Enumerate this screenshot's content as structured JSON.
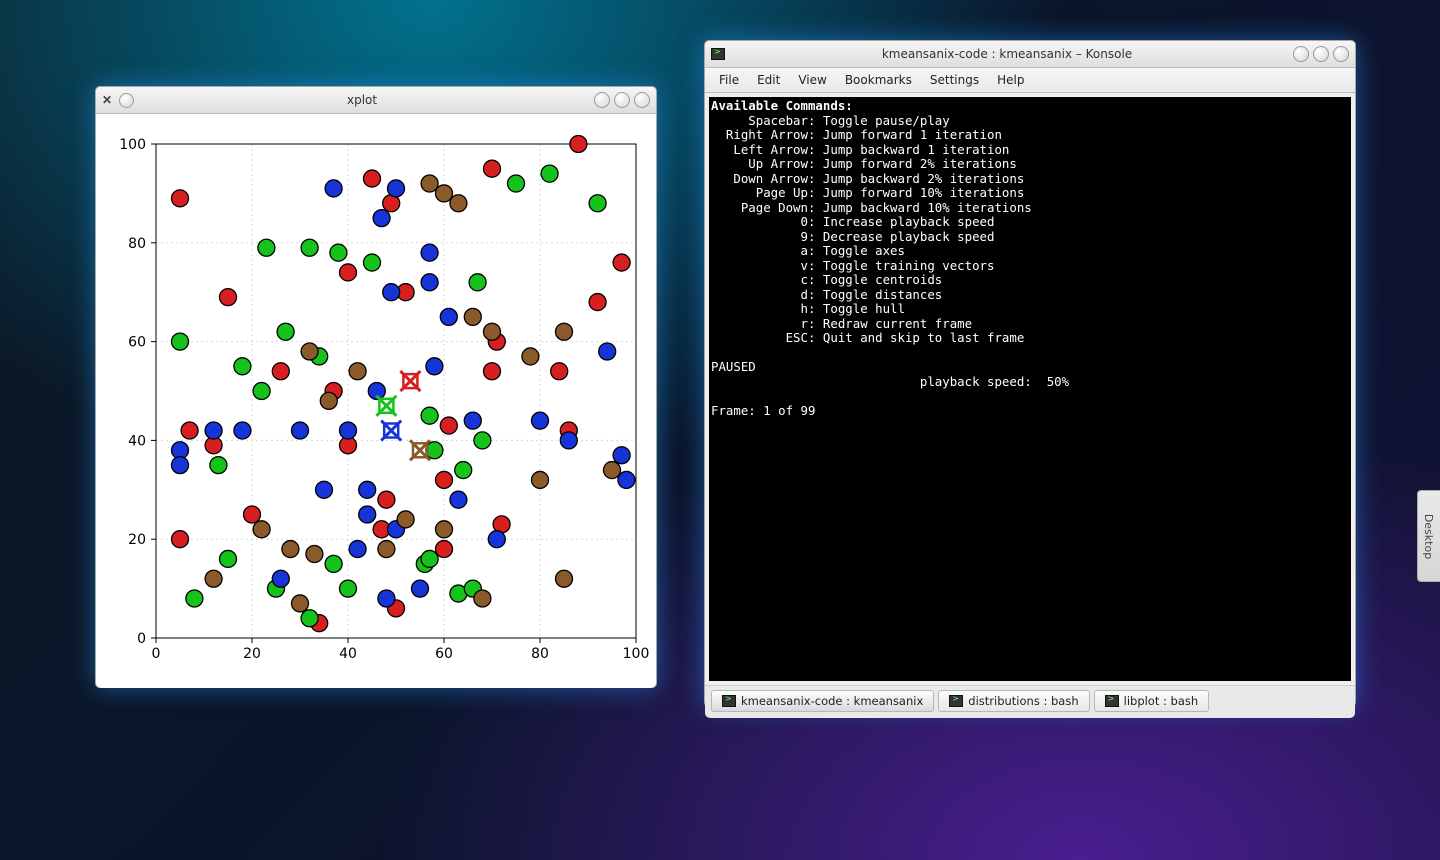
{
  "xplot": {
    "title": "xplot"
  },
  "konsole": {
    "title": "kmeansanix-code : kmeansanix – Konsole",
    "menu": [
      "File",
      "Edit",
      "View",
      "Bookmarks",
      "Settings",
      "Help"
    ],
    "tabs": [
      {
        "label": "kmeansanix-code : kmeansanix",
        "active": true
      },
      {
        "label": "distributions : bash",
        "active": false
      },
      {
        "label": "libplot : bash",
        "active": false
      }
    ],
    "terminal": {
      "heading": "Available Commands:",
      "cmds": [
        [
          "Spacebar",
          "Toggle pause/play"
        ],
        [
          "Right Arrow",
          "Jump forward 1 iteration"
        ],
        [
          "Left Arrow",
          "Jump backward 1 iteration"
        ],
        [
          "Up Arrow",
          "Jump forward 2% iterations"
        ],
        [
          "Down Arrow",
          "Jump backward 2% iterations"
        ],
        [
          "Page Up",
          "Jump forward 10% iterations"
        ],
        [
          "Page Down",
          "Jump backward 10% iterations"
        ],
        [
          "0",
          "Increase playback speed"
        ],
        [
          "9",
          "Decrease playback speed"
        ],
        [
          "a",
          "Toggle axes"
        ],
        [
          "v",
          "Toggle training vectors"
        ],
        [
          "c",
          "Toggle centroids"
        ],
        [
          "d",
          "Toggle distances"
        ],
        [
          "h",
          "Toggle hull"
        ],
        [
          "r",
          "Redraw current frame"
        ],
        [
          "ESC",
          "Quit and skip to last frame"
        ]
      ],
      "status_paused": "PAUSED",
      "speed_label": "playback speed:",
      "speed_value": "50%",
      "frame_line": "Frame: 1 of 99"
    }
  },
  "side_strip": {
    "label": "Desktop"
  },
  "chart_data": {
    "type": "scatter",
    "title": "",
    "xlabel": "",
    "ylabel": "",
    "xlim": [
      0,
      100
    ],
    "ylim": [
      0,
      100
    ],
    "x_ticks": [
      0,
      20,
      40,
      60,
      80,
      100
    ],
    "y_ticks": [
      0,
      20,
      40,
      60,
      80,
      100
    ],
    "grid": true,
    "centroids": [
      {
        "name": "red",
        "color": "#d81f1f",
        "x": 53,
        "y": 52
      },
      {
        "name": "green",
        "color": "#16c31a",
        "x": 48,
        "y": 47
      },
      {
        "name": "blue",
        "color": "#1634d8",
        "x": 49,
        "y": 42
      },
      {
        "name": "brown",
        "color": "#8a5a2a",
        "x": 55,
        "y": 38
      }
    ],
    "series": [
      {
        "name": "red",
        "color": "#d81f1f",
        "points": [
          [
            5,
            89
          ],
          [
            15,
            69
          ],
          [
            40,
            74
          ],
          [
            45,
            93
          ],
          [
            49,
            88
          ],
          [
            52,
            70
          ],
          [
            70,
            95
          ],
          [
            71,
            60
          ],
          [
            88,
            100
          ],
          [
            97,
            76
          ],
          [
            26,
            54
          ],
          [
            37,
            50
          ],
          [
            40,
            39
          ],
          [
            61,
            43
          ],
          [
            60,
            32
          ],
          [
            70,
            54
          ],
          [
            84,
            54
          ],
          [
            92,
            68
          ],
          [
            48,
            28
          ],
          [
            47,
            22
          ],
          [
            60,
            18
          ],
          [
            86,
            42
          ],
          [
            72,
            23
          ],
          [
            50,
            6
          ],
          [
            34,
            3
          ],
          [
            5,
            20
          ],
          [
            12,
            39
          ],
          [
            20,
            25
          ],
          [
            7,
            42
          ]
        ]
      },
      {
        "name": "green",
        "color": "#16c31a",
        "points": [
          [
            23,
            79
          ],
          [
            32,
            79
          ],
          [
            38,
            78
          ],
          [
            45,
            76
          ],
          [
            67,
            72
          ],
          [
            75,
            92
          ],
          [
            82,
            94
          ],
          [
            92,
            88
          ],
          [
            5,
            60
          ],
          [
            13,
            35
          ],
          [
            18,
            55
          ],
          [
            22,
            50
          ],
          [
            27,
            62
          ],
          [
            34,
            57
          ],
          [
            57,
            45
          ],
          [
            58,
            38
          ],
          [
            64,
            34
          ],
          [
            68,
            40
          ],
          [
            15,
            16
          ],
          [
            25,
            10
          ],
          [
            37,
            15
          ],
          [
            40,
            10
          ],
          [
            56,
            15
          ],
          [
            57,
            16
          ],
          [
            63,
            9
          ],
          [
            66,
            10
          ],
          [
            32,
            4
          ],
          [
            8,
            8
          ]
        ]
      },
      {
        "name": "blue",
        "color": "#1634d8",
        "points": [
          [
            37,
            91
          ],
          [
            50,
            91
          ],
          [
            47,
            85
          ],
          [
            49,
            70
          ],
          [
            57,
            78
          ],
          [
            57,
            72
          ],
          [
            61,
            65
          ],
          [
            58,
            55
          ],
          [
            46,
            50
          ],
          [
            40,
            42
          ],
          [
            30,
            42
          ],
          [
            18,
            42
          ],
          [
            12,
            42
          ],
          [
            5,
            38
          ],
          [
            5,
            35
          ],
          [
            66,
            44
          ],
          [
            80,
            44
          ],
          [
            86,
            40
          ],
          [
            94,
            58
          ],
          [
            97,
            37
          ],
          [
            98,
            32
          ],
          [
            35,
            30
          ],
          [
            44,
            30
          ],
          [
            44,
            25
          ],
          [
            42,
            18
          ],
          [
            50,
            22
          ],
          [
            55,
            10
          ],
          [
            48,
            8
          ],
          [
            26,
            12
          ],
          [
            63,
            28
          ],
          [
            71,
            20
          ]
        ]
      },
      {
        "name": "brown",
        "color": "#8a5a2a",
        "points": [
          [
            57,
            92
          ],
          [
            60,
            90
          ],
          [
            63,
            88
          ],
          [
            66,
            65
          ],
          [
            70,
            62
          ],
          [
            78,
            57
          ],
          [
            85,
            62
          ],
          [
            32,
            58
          ],
          [
            42,
            54
          ],
          [
            36,
            48
          ],
          [
            22,
            22
          ],
          [
            28,
            18
          ],
          [
            33,
            17
          ],
          [
            48,
            18
          ],
          [
            52,
            24
          ],
          [
            60,
            22
          ],
          [
            80,
            32
          ],
          [
            12,
            12
          ],
          [
            30,
            7
          ],
          [
            68,
            8
          ],
          [
            85,
            12
          ],
          [
            95,
            34
          ]
        ]
      }
    ]
  }
}
